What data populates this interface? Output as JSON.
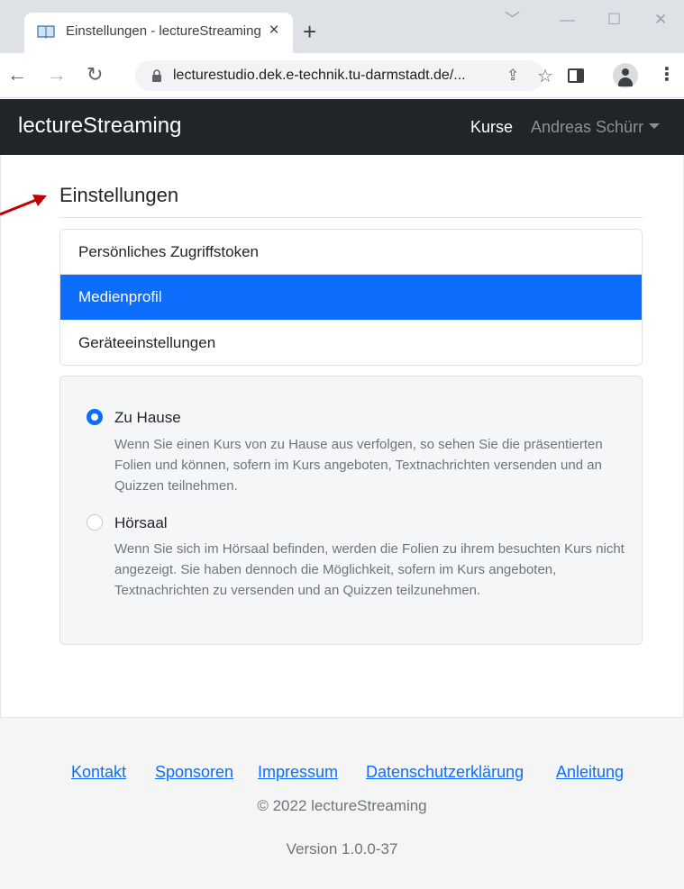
{
  "browser": {
    "tab_title": "Einstellungen - lectureStreaming",
    "tab_close": "×",
    "new_tab": "+",
    "url": "lecturestudio.dek.e-technik.tu-darmstadt.de/...",
    "icons": [
      "book-icon",
      "close-icon",
      "plus-icon",
      "back-icon",
      "forward-icon",
      "reload-icon",
      "lock-icon",
      "share-icon",
      "star-icon",
      "side-panel-icon",
      "profile-icon",
      "menu-icon"
    ]
  },
  "navbar": {
    "brand": "lectureStreaming",
    "kurse": "Kurse",
    "user": "Andreas Schürr",
    "background": "#212529"
  },
  "page": {
    "title": "Einstellungen",
    "menu": [
      {
        "label": "Persönliches Zugriffstoken",
        "active": false
      },
      {
        "label": "Medienprofil",
        "active": true
      },
      {
        "label": "Geräteeinstellungen",
        "active": false
      }
    ],
    "accent": "#0d6efd",
    "options": [
      {
        "label": "Zu Hause",
        "checked": true,
        "description": "Wenn Sie einen Kurs von zu Hause aus verfolgen, so sehen Sie die präsentierten Folien und können, sofern im Kurs angeboten, Textnachrichten versenden und an Quizzen teilnehmen."
      },
      {
        "label": "Hörsaal",
        "checked": false,
        "description": "Wenn Sie sich im Hörsaal befinden, werden die Folien zu ihrem besuchten Kurs nicht angezeigt. Sie haben dennoch die Möglichkeit, sofern im Kurs angeboten, Textnachrichten zu versenden und an Quizzen teilzunehmen."
      }
    ]
  },
  "footer": {
    "links": [
      "Kontakt",
      "Sponsoren",
      "Impressum",
      "Datenschutzerklärung",
      "Anleitung"
    ],
    "copyright": "© 2022 lectureStreaming",
    "version": "Version 1.0.0-37"
  }
}
